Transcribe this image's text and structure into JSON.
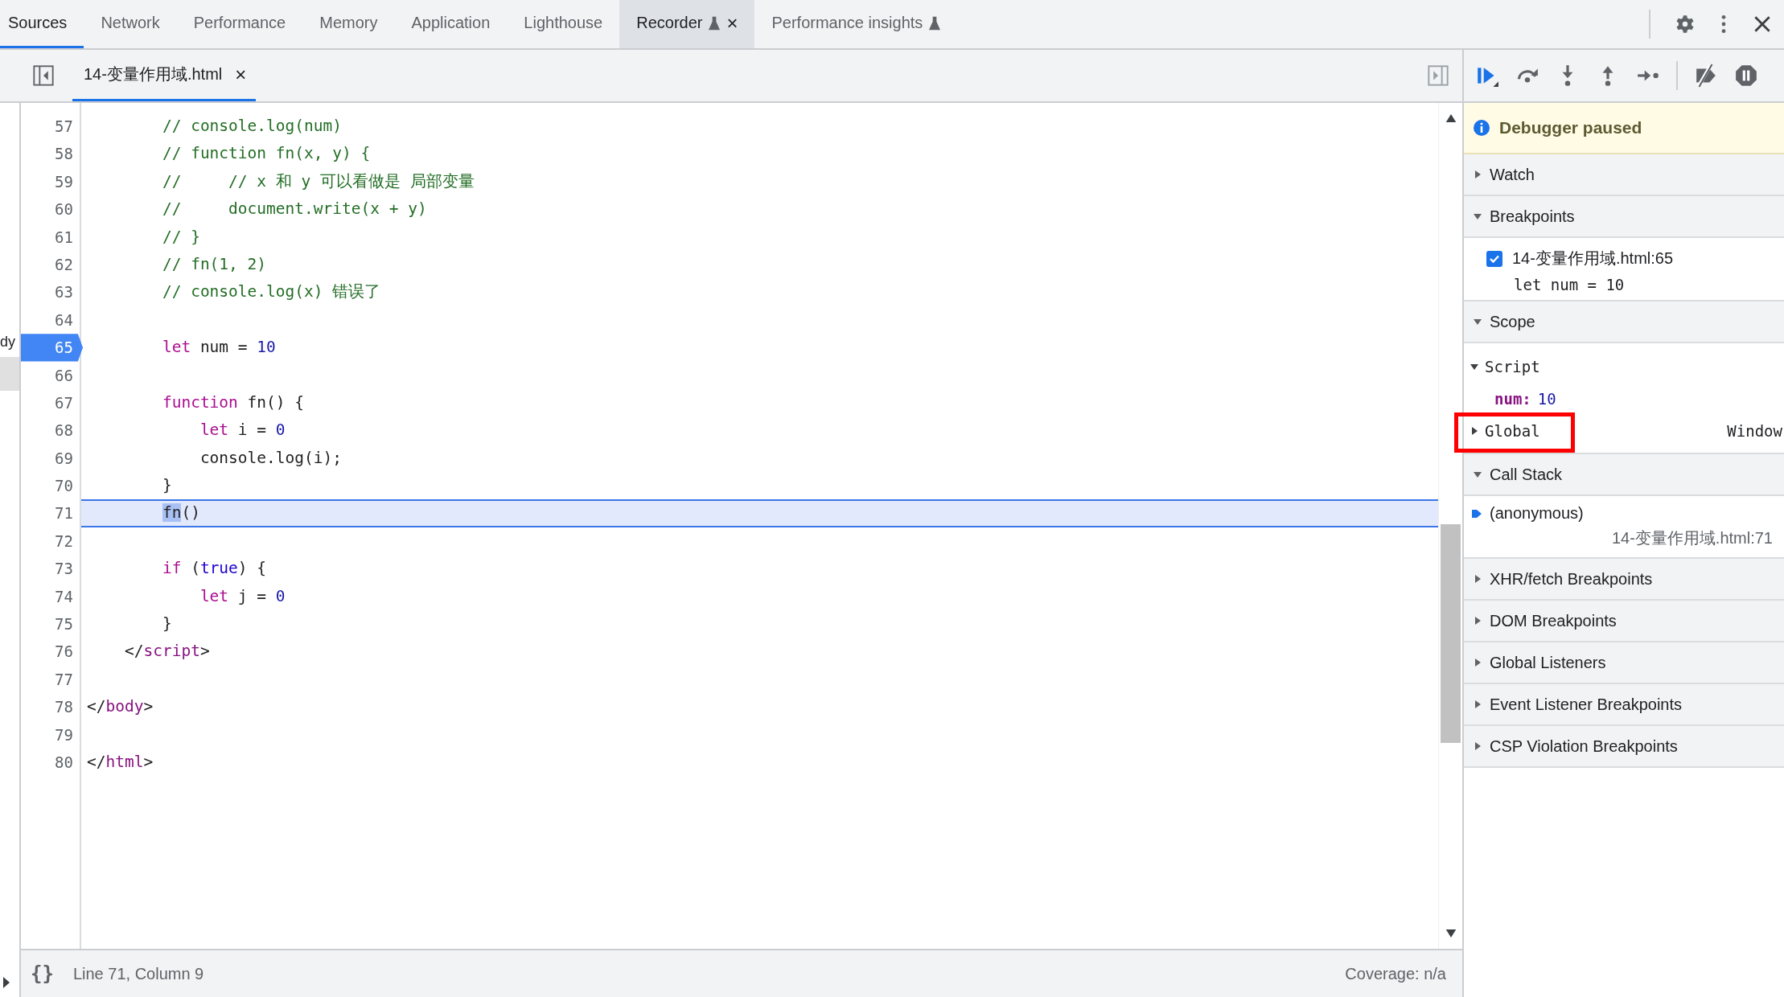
{
  "top_tabs": [
    {
      "label": "Sources",
      "selected": true,
      "hovered": false
    },
    {
      "label": "Network",
      "selected": false,
      "hovered": false
    },
    {
      "label": "Performance",
      "selected": false,
      "hovered": false
    },
    {
      "label": "Memory",
      "selected": false,
      "hovered": false
    },
    {
      "label": "Application",
      "selected": false,
      "hovered": false
    },
    {
      "label": "Lighthouse",
      "selected": false,
      "hovered": false
    },
    {
      "label": "Recorder",
      "selected": false,
      "hovered": true,
      "experimental": true,
      "close": "×"
    },
    {
      "label": "Performance insights",
      "selected": false,
      "hovered": false,
      "experimental": true
    }
  ],
  "sidebar_clip": "dy",
  "file_tab": {
    "label": "14-变量作用域.html",
    "selected": true,
    "close": "×"
  },
  "code": {
    "lines": [
      {
        "number": "57",
        "breakpoint": false,
        "current": false,
        "tokens": [
          {
            "kind": "comment",
            "text": "        // console.log(num)"
          }
        ]
      },
      {
        "number": "58",
        "breakpoint": false,
        "current": false,
        "tokens": [
          {
            "kind": "comment",
            "text": "        // function fn(x, y) {"
          }
        ]
      },
      {
        "number": "59",
        "breakpoint": false,
        "current": false,
        "tokens": [
          {
            "kind": "comment",
            "text": "        //     // x 和 y 可以看做是 局部变量"
          }
        ]
      },
      {
        "number": "60",
        "breakpoint": false,
        "current": false,
        "tokens": [
          {
            "kind": "comment",
            "text": "        //     document.write(x + y)"
          }
        ]
      },
      {
        "number": "61",
        "breakpoint": false,
        "current": false,
        "tokens": [
          {
            "kind": "comment",
            "text": "        // }"
          }
        ]
      },
      {
        "number": "62",
        "breakpoint": false,
        "current": false,
        "tokens": [
          {
            "kind": "comment",
            "text": "        // fn(1, 2)"
          }
        ]
      },
      {
        "number": "63",
        "breakpoint": false,
        "current": false,
        "tokens": [
          {
            "kind": "comment",
            "text": "        // console.log(x) 错误了"
          }
        ]
      },
      {
        "number": "64",
        "breakpoint": false,
        "current": false
      },
      {
        "number": "65",
        "breakpoint": true,
        "current": false,
        "tokens": [
          {
            "kind": "keyword",
            "text": "        let"
          },
          {
            "kind": "plain",
            "text": " num = "
          },
          {
            "kind": "number",
            "text": "10"
          }
        ]
      },
      {
        "number": "66",
        "breakpoint": false,
        "current": false
      },
      {
        "number": "67",
        "breakpoint": false,
        "current": false,
        "tokens": [
          {
            "kind": "keyword",
            "text": "        function"
          },
          {
            "kind": "plain",
            "text": " fn() {"
          }
        ]
      },
      {
        "number": "68",
        "breakpoint": false,
        "current": false,
        "tokens": [
          {
            "kind": "keyword",
            "text": "            let"
          },
          {
            "kind": "plain",
            "text": " i = "
          },
          {
            "kind": "number",
            "text": "0"
          }
        ]
      },
      {
        "number": "69",
        "breakpoint": false,
        "current": false,
        "tokens": [
          {
            "kind": "plain",
            "text": "            console.log(i);"
          }
        ]
      },
      {
        "number": "70",
        "breakpoint": false,
        "current": false,
        "tokens": [
          {
            "kind": "plain",
            "text": "        }"
          }
        ]
      },
      {
        "number": "71",
        "breakpoint": false,
        "current": true,
        "tokens": [
          {
            "kind": "exec",
            "text": "        fn"
          },
          {
            "kind": "plain",
            "text": "()"
          }
        ]
      },
      {
        "number": "72",
        "breakpoint": false,
        "current": false
      },
      {
        "number": "73",
        "breakpoint": false,
        "current": false,
        "tokens": [
          {
            "kind": "keyword",
            "text": "        if"
          },
          {
            "kind": "plain",
            "text": " ("
          },
          {
            "kind": "atom",
            "text": "true"
          },
          {
            "kind": "plain",
            "text": ") {"
          }
        ]
      },
      {
        "number": "74",
        "breakpoint": false,
        "current": false,
        "tokens": [
          {
            "kind": "keyword",
            "text": "            let"
          },
          {
            "kind": "plain",
            "text": " j = "
          },
          {
            "kind": "number",
            "text": "0"
          }
        ]
      },
      {
        "number": "75",
        "breakpoint": false,
        "current": false,
        "tokens": [
          {
            "kind": "plain",
            "text": "        }"
          }
        ]
      },
      {
        "number": "76",
        "breakpoint": false,
        "current": false,
        "tokens": [
          {
            "kind": "plain",
            "text": "    </"
          },
          {
            "kind": "tag",
            "text": "script"
          },
          {
            "kind": "plain",
            "text": ">"
          }
        ]
      },
      {
        "number": "77",
        "breakpoint": false,
        "current": false
      },
      {
        "number": "78",
        "breakpoint": false,
        "current": false,
        "tokens": [
          {
            "kind": "plain",
            "text": "</"
          },
          {
            "kind": "tag",
            "text": "body"
          },
          {
            "kind": "plain",
            "text": ">"
          }
        ]
      },
      {
        "number": "79",
        "breakpoint": false,
        "current": false
      },
      {
        "number": "80",
        "breakpoint": false,
        "current": false,
        "tokens": [
          {
            "kind": "plain",
            "text": "</"
          },
          {
            "kind": "tag",
            "text": "html"
          },
          {
            "kind": "plain",
            "text": ">"
          }
        ]
      }
    ]
  },
  "status_bar": {
    "format": "{}",
    "position": "Line 71, Column 9",
    "coverage": "Coverage: n/a"
  },
  "debugger": {
    "banner": "Debugger paused",
    "sections": [
      {
        "title": "Watch",
        "expanded": false,
        "kind": "plain"
      },
      {
        "title": "Breakpoints",
        "expanded": true,
        "kind": "breakpoints",
        "items": [
          {
            "file": "14-变量作用域.html:65",
            "code": "let num = 10",
            "checked": true
          }
        ]
      },
      {
        "title": "Scope",
        "expanded": true,
        "kind": "scope",
        "scopes": [
          {
            "name": "Script",
            "expanded": true,
            "highlighted": false,
            "vars": [
              {
                "name": "num:",
                "value": "10"
              }
            ]
          },
          {
            "name": "Global",
            "expanded": false,
            "highlighted": true,
            "value": "Window"
          }
        ]
      },
      {
        "title": "Call Stack",
        "expanded": true,
        "kind": "callstack",
        "frames": [
          {
            "name": "(anonymous)",
            "location": "14-变量作用域.html:71",
            "selected": true
          }
        ]
      },
      {
        "title": "XHR/fetch Breakpoints",
        "expanded": false,
        "kind": "plain"
      },
      {
        "title": "DOM Breakpoints",
        "expanded": false,
        "kind": "plain"
      },
      {
        "title": "Global Listeners",
        "expanded": false,
        "kind": "plain"
      },
      {
        "title": "Event Listener Breakpoints",
        "expanded": false,
        "kind": "plain"
      },
      {
        "title": "CSP Violation Breakpoints",
        "expanded": false,
        "kind": "plain"
      }
    ]
  }
}
